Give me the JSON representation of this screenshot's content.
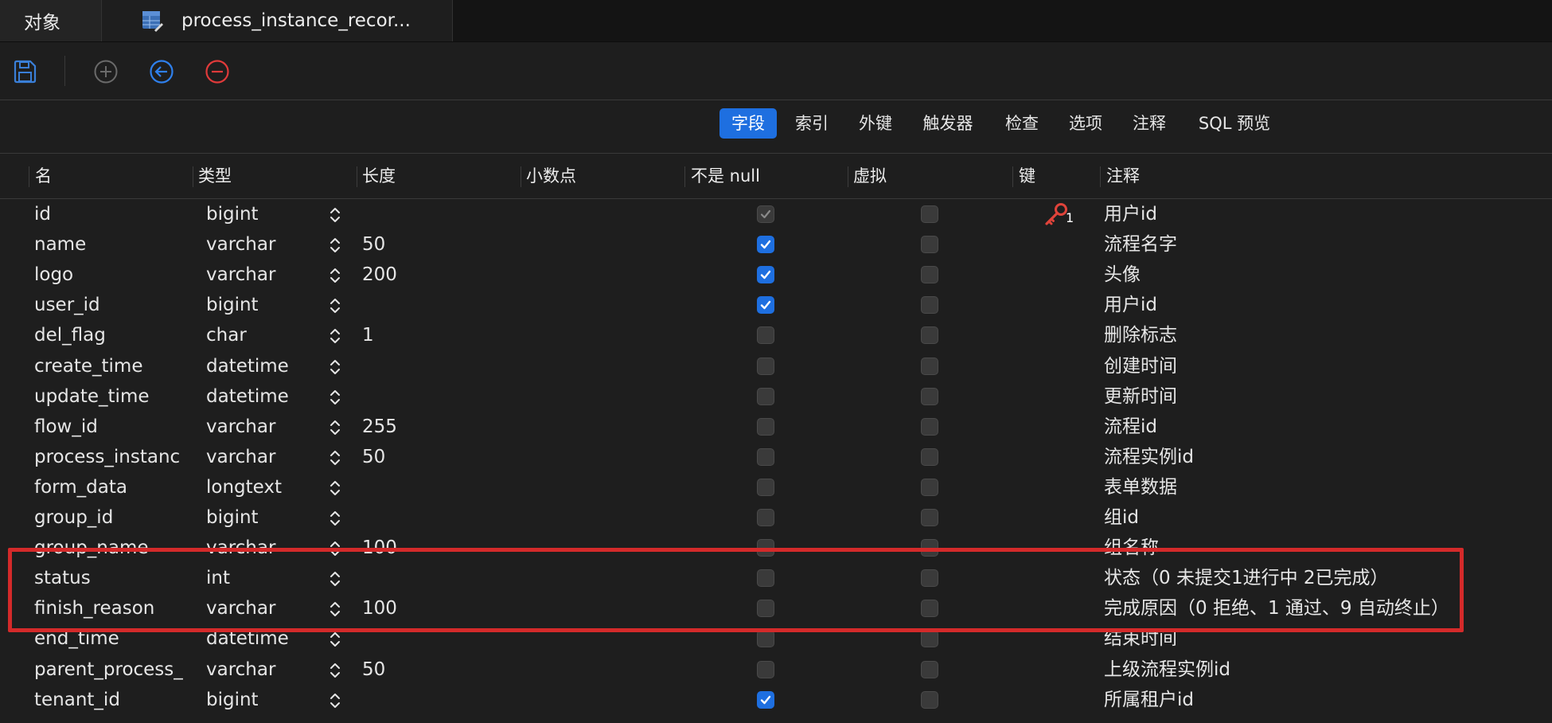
{
  "tabs": {
    "objects_label": "对象",
    "table_tab_label": "process_instance_recor..."
  },
  "toolbar": {
    "save": "save-icon",
    "add": "add-circle-icon",
    "back": "back-circle-icon",
    "delete": "minus-circle-icon"
  },
  "subtabs": [
    "字段",
    "索引",
    "外键",
    "触发器",
    "检查",
    "选项",
    "注释",
    "SQL 预览"
  ],
  "columns": [
    "名",
    "类型",
    "长度",
    "小数点",
    "不是 null",
    "虚拟",
    "键",
    "注释"
  ],
  "fields": [
    {
      "name": "id",
      "type": "bigint",
      "length": "",
      "not_null": true,
      "not_null_disabled": true,
      "virtual": false,
      "key": "1",
      "comment": "用户id"
    },
    {
      "name": "name",
      "type": "varchar",
      "length": "50",
      "not_null": true,
      "virtual": false,
      "key": "",
      "comment": "流程名字"
    },
    {
      "name": "logo",
      "type": "varchar",
      "length": "200",
      "not_null": true,
      "virtual": false,
      "key": "",
      "comment": "头像"
    },
    {
      "name": "user_id",
      "type": "bigint",
      "length": "",
      "not_null": true,
      "virtual": false,
      "key": "",
      "comment": "用户id"
    },
    {
      "name": "del_flag",
      "type": "char",
      "length": "1",
      "not_null": false,
      "virtual": false,
      "key": "",
      "comment": "删除标志"
    },
    {
      "name": "create_time",
      "type": "datetime",
      "length": "",
      "not_null": false,
      "virtual": false,
      "key": "",
      "comment": "创建时间"
    },
    {
      "name": "update_time",
      "type": "datetime",
      "length": "",
      "not_null": false,
      "virtual": false,
      "key": "",
      "comment": "更新时间"
    },
    {
      "name": "flow_id",
      "type": "varchar",
      "length": "255",
      "not_null": false,
      "virtual": false,
      "key": "",
      "comment": "流程id"
    },
    {
      "name": "process_instanc",
      "type": "varchar",
      "length": "50",
      "not_null": false,
      "virtual": false,
      "key": "",
      "comment": "流程实例id"
    },
    {
      "name": "form_data",
      "type": "longtext",
      "length": "",
      "not_null": false,
      "virtual": false,
      "key": "",
      "comment": "表单数据"
    },
    {
      "name": "group_id",
      "type": "bigint",
      "length": "",
      "not_null": false,
      "virtual": false,
      "key": "",
      "comment": "组id"
    },
    {
      "name": "group_name",
      "type": "varchar",
      "length": "100",
      "not_null": false,
      "virtual": false,
      "key": "",
      "comment": "组名称"
    },
    {
      "name": "status",
      "type": "int",
      "length": "",
      "not_null": false,
      "virtual": false,
      "key": "",
      "comment": "状态（0 未提交1进行中 2已完成）"
    },
    {
      "name": "finish_reason",
      "type": "varchar",
      "length": "100",
      "not_null": false,
      "virtual": false,
      "key": "",
      "comment": "完成原因（0 拒绝、1 通过、9 自动终止）"
    },
    {
      "name": "end_time",
      "type": "datetime",
      "length": "",
      "not_null": false,
      "virtual": false,
      "key": "",
      "comment": "结束时间"
    },
    {
      "name": "parent_process_",
      "type": "varchar",
      "length": "50",
      "not_null": false,
      "virtual": false,
      "key": "",
      "comment": "上级流程实例id"
    },
    {
      "name": "tenant_id",
      "type": "bigint",
      "length": "",
      "not_null": true,
      "virtual": false,
      "key": "",
      "comment": "所属租户id"
    }
  ],
  "colors": {
    "accent": "#1e6fe0",
    "highlight": "#d42a2a",
    "key_icon": "#e0433a"
  }
}
